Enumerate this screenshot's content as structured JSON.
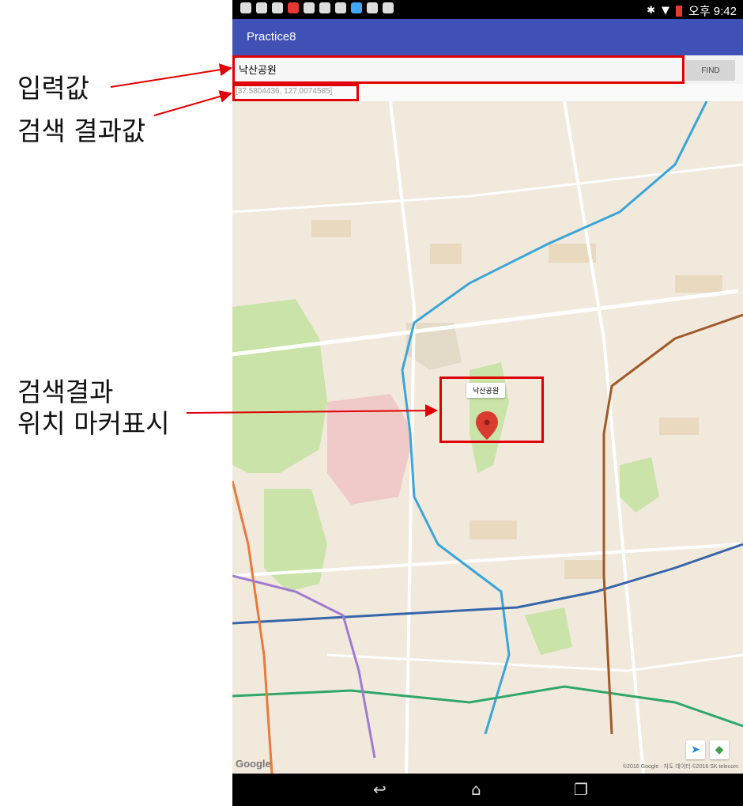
{
  "annotations": {
    "input_label": "입력값",
    "result_label": "검색 결과값",
    "marker_label_line1": "검색결과",
    "marker_label_line2": "위치 마커표시"
  },
  "status_bar": {
    "time": "오후 9:42"
  },
  "app": {
    "title": "Practice8"
  },
  "search": {
    "value": "낙산공원",
    "find_label": "FIND",
    "result": "[37.5804436, 127.0074585]"
  },
  "map": {
    "marker_title": "낙산공원",
    "google_logo": "Google",
    "attribution": "©2016 Google · 지도 데이터 ©2016 SK telecom",
    "colors": {
      "background": "#f2e9dd",
      "park": "#c9e3a8",
      "route_blue": "#3aa5d8",
      "route_orange": "#e87a3a",
      "route_purple": "#a07ad0",
      "route_green": "#2fa66a",
      "route_navy": "#3566a8",
      "route_brown": "#a05a2a",
      "marker": "#d93b2f"
    }
  },
  "navigation": {
    "back_icon": "back-icon",
    "home_icon": "home-icon",
    "recent_icon": "recent-apps-icon"
  }
}
